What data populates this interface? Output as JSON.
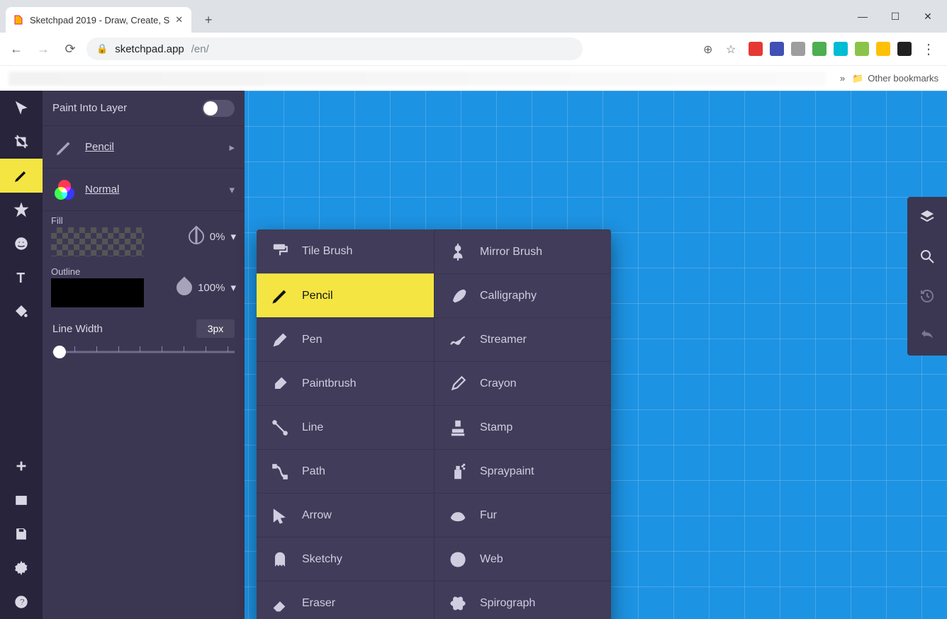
{
  "browser": {
    "tab_title": "Sketchpad 2019 - Draw, Create, S",
    "url_host": "sketchpad.app",
    "url_path": "/en/",
    "other_bookmarks": "Other bookmarks"
  },
  "left_rail": {
    "items": [
      {
        "icon": "cursor-icon"
      },
      {
        "icon": "crop-icon"
      },
      {
        "icon": "pencil-icon",
        "active": true
      },
      {
        "icon": "star-icon"
      },
      {
        "icon": "emoji-icon"
      },
      {
        "icon": "text-icon"
      },
      {
        "icon": "bucket-icon"
      }
    ],
    "bottom": [
      {
        "icon": "plus-icon"
      },
      {
        "icon": "folder-icon"
      },
      {
        "icon": "save-icon"
      },
      {
        "icon": "settings-icon"
      },
      {
        "icon": "help-icon"
      }
    ]
  },
  "panel": {
    "paint_into_layer": "Paint Into Layer",
    "tool_label": "Pencil",
    "blend_label": "Normal",
    "fill_label": "Fill",
    "fill_opacity": "0%",
    "outline_label": "Outline",
    "outline_opacity": "100%",
    "line_width_label": "Line Width",
    "line_width_value": "3px"
  },
  "brush_menu": {
    "left": [
      "Tile Brush",
      "Pencil",
      "Pen",
      "Paintbrush",
      "Line",
      "Path",
      "Arrow",
      "Sketchy",
      "Eraser"
    ],
    "right": [
      "Mirror Brush",
      "Calligraphy",
      "Streamer",
      "Crayon",
      "Stamp",
      "Spraypaint",
      "Fur",
      "Web",
      "Spirograph"
    ],
    "active": "Pencil"
  },
  "right_rail": {
    "items": [
      "layers-icon",
      "search-icon",
      "history-icon",
      "undo-icon"
    ]
  }
}
